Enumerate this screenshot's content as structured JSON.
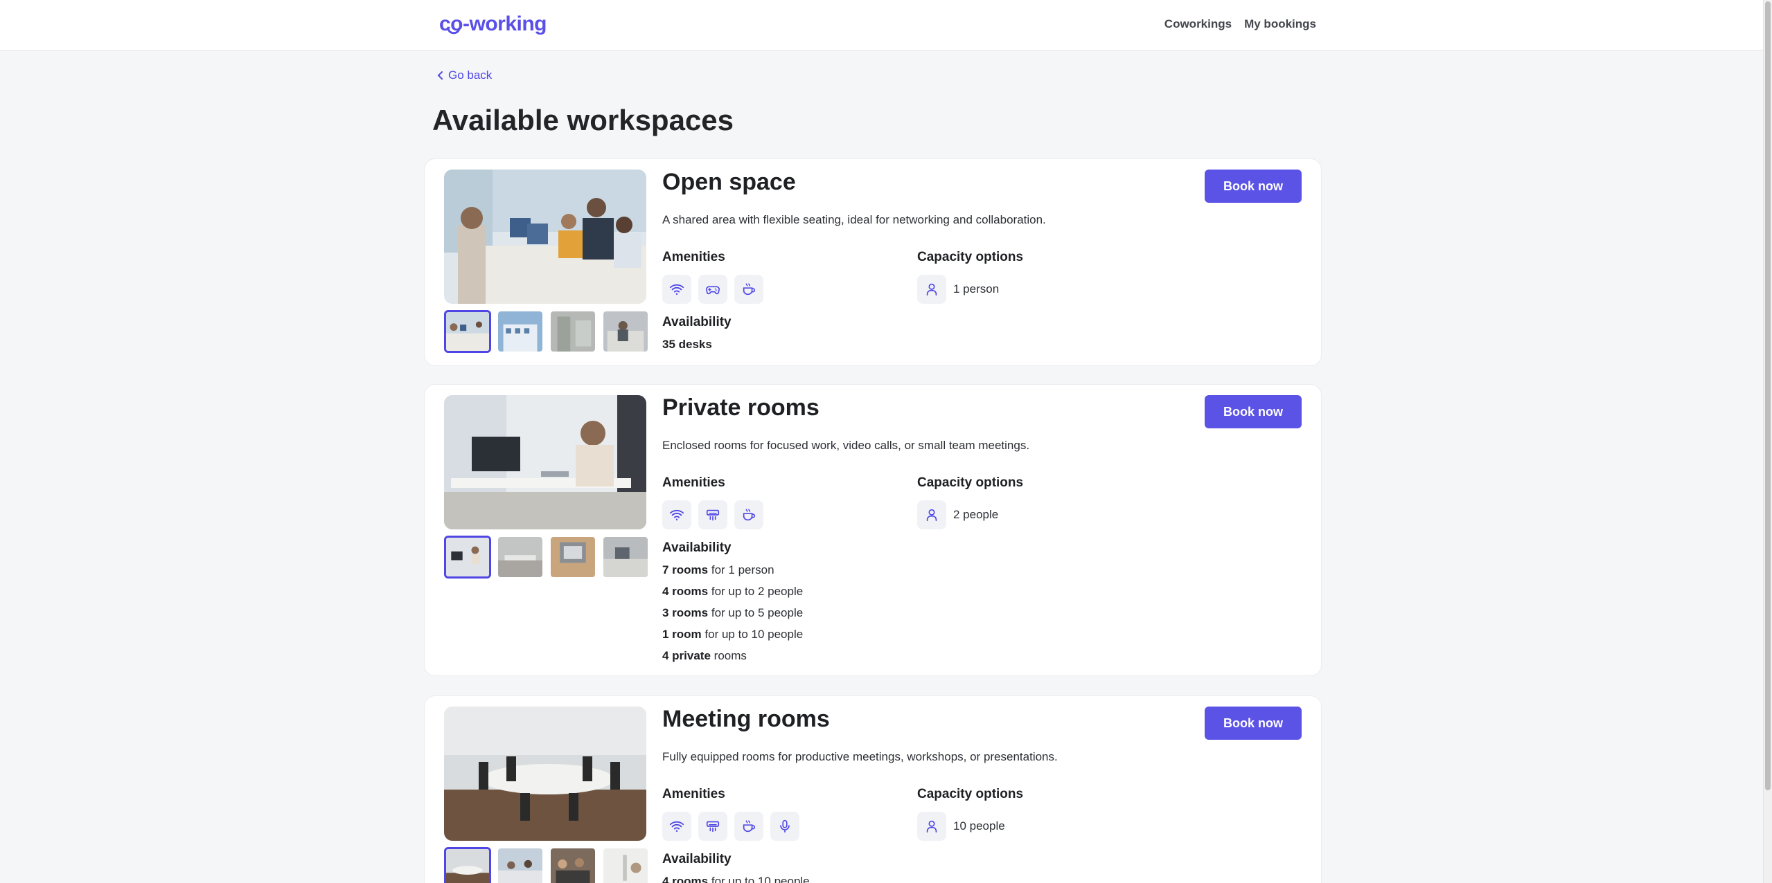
{
  "header": {
    "logo": "co-working",
    "nav": [
      "Coworkings",
      "My bookings"
    ]
  },
  "go_back": "Go back",
  "page_title": "Available workspaces",
  "colors": {
    "accent": "#5b52e6",
    "link": "#4f46e5",
    "background": "#f5f6f8"
  },
  "labels": {
    "amenities": "Amenities",
    "capacity": "Capacity options",
    "availability": "Availability",
    "book": "Book now"
  },
  "workspaces": [
    {
      "title": "Open space",
      "description": "A shared area with flexible seating, ideal for networking and collaboration.",
      "amenities": [
        "wifi-icon",
        "gamepad-icon",
        "coffee-icon"
      ],
      "capacity": "1 person",
      "availability": [
        {
          "bold": "35 desks",
          "rest": ""
        }
      ]
    },
    {
      "title": "Private rooms",
      "description": "Enclosed rooms for focused work, video calls, or small team meetings.",
      "amenities": [
        "wifi-icon",
        "air-conditioner-icon",
        "coffee-icon"
      ],
      "capacity": "2 people",
      "availability": [
        {
          "bold": "7 rooms",
          "rest": " for 1 person"
        },
        {
          "bold": "4 rooms",
          "rest": " for up to 2 people"
        },
        {
          "bold": "3 rooms",
          "rest": " for up to 5 people"
        },
        {
          "bold": "1 room",
          "rest": " for up to 10 people"
        },
        {
          "bold": "4 private",
          "rest": " rooms"
        }
      ]
    },
    {
      "title": "Meeting rooms",
      "description": "Fully equipped rooms for productive meetings, workshops, or presentations.",
      "amenities": [
        "wifi-icon",
        "air-conditioner-icon",
        "coffee-icon",
        "microphone-icon"
      ],
      "capacity": "10 people",
      "availability": [
        {
          "bold": "4 rooms",
          "rest": " for up to 10 people"
        }
      ]
    }
  ]
}
